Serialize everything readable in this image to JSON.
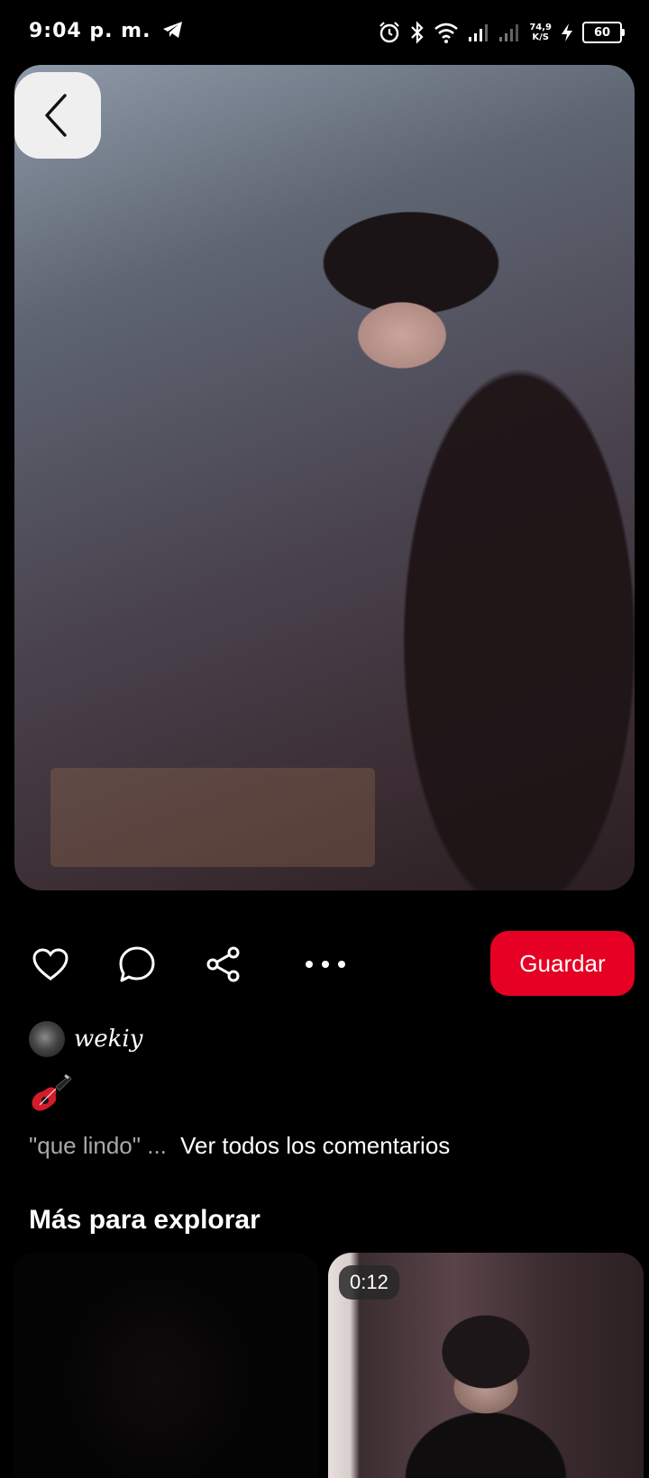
{
  "status_bar": {
    "time": "9:04 p. m.",
    "net_speed_value": "74,9",
    "net_speed_unit": "K/S",
    "battery": "60",
    "icons": [
      "telegram-icon",
      "alarm-icon",
      "bluetooth-icon",
      "wifi-icon",
      "signal-icon",
      "signal-icon",
      "charging-icon",
      "battery-icon"
    ]
  },
  "pin": {
    "image": "photo of a smiling person in a black headband and braids",
    "back_icon": "chevron-left-icon"
  },
  "actions": {
    "like_icon": "heart-icon",
    "comment_icon": "comment-icon",
    "share_icon": "share-icon",
    "more_icon": "more-icon",
    "save_label": "Guardar"
  },
  "author": {
    "name": "wekiy"
  },
  "description": {
    "emoji_icon": "guitar-icon"
  },
  "comments": {
    "preview": "\"que lindo\" ...",
    "view_all_label": "Ver todos los comentarios"
  },
  "explore": {
    "title": "Más para explorar",
    "cards": [
      {
        "kind": "dark-image"
      },
      {
        "kind": "video",
        "duration": "0:12"
      }
    ]
  },
  "colors": {
    "background": "#000000",
    "accent": "#e60023",
    "muted_text": "#a9a9a9"
  }
}
